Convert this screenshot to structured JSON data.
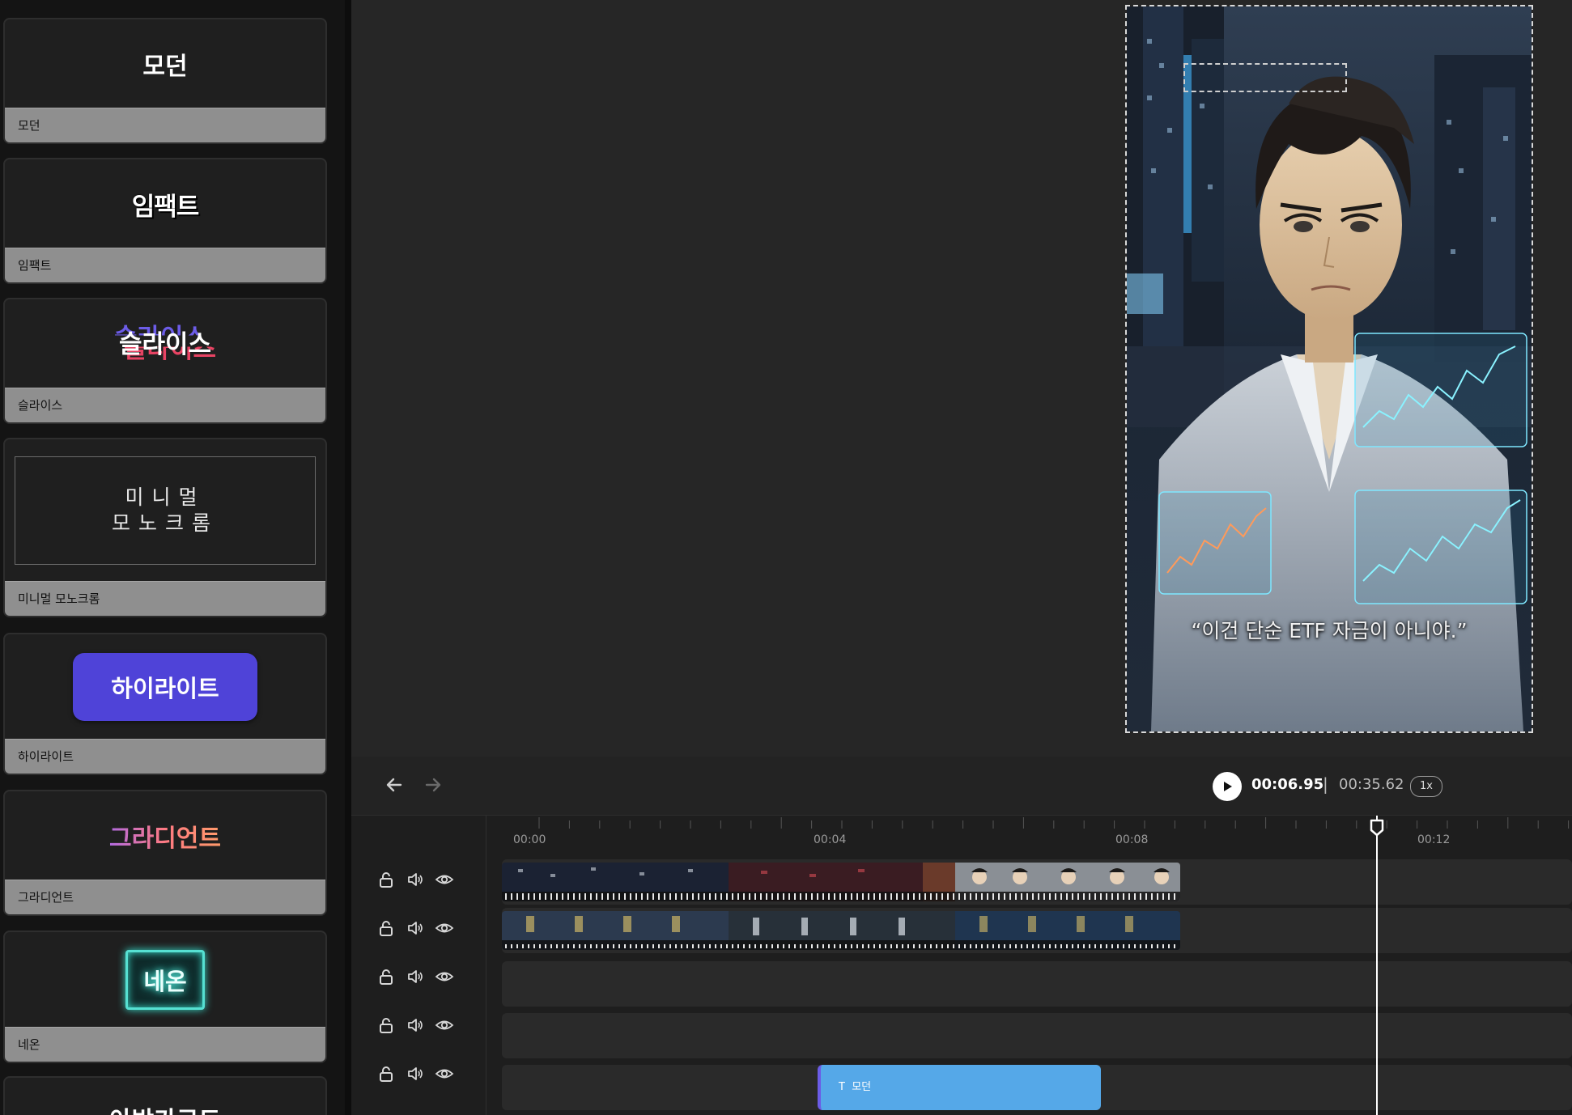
{
  "style_panel": {
    "cards": [
      {
        "id": "modern",
        "preview": "모던",
        "label": "모던"
      },
      {
        "id": "impact",
        "preview": "임팩트",
        "label": "임팩트"
      },
      {
        "id": "slice",
        "preview": "슬라이스",
        "label": "슬라이스"
      },
      {
        "id": "minimal",
        "preview_line1": "미니멀",
        "preview_line2": "모노크롬",
        "label": "미니멀 모노크롬"
      },
      {
        "id": "highlight",
        "preview": "하이라이트",
        "label": "하이라이트"
      },
      {
        "id": "gradient",
        "preview": "그라디언트",
        "label": "그라디언트"
      },
      {
        "id": "neon",
        "preview": "네온",
        "label": "네온"
      },
      {
        "id": "partial",
        "preview": "아방가르드"
      }
    ]
  },
  "preview": {
    "subtitle": "“이건 단순 ETF 자금이 아니야.”"
  },
  "controls": {
    "current_time": "00:06.95",
    "separator": "|",
    "total_time": "00:35.62",
    "speed": "1x"
  },
  "timeline": {
    "ruler_labels": [
      "00:00",
      "00:04",
      "00:08",
      "00:12"
    ],
    "tracks": [
      {
        "type": "video"
      },
      {
        "type": "video"
      },
      {
        "type": "empty"
      },
      {
        "type": "empty"
      },
      {
        "type": "text",
        "clip_label": "모던",
        "clip_icon": "T"
      }
    ],
    "playhead_time": "00:06.95"
  }
}
